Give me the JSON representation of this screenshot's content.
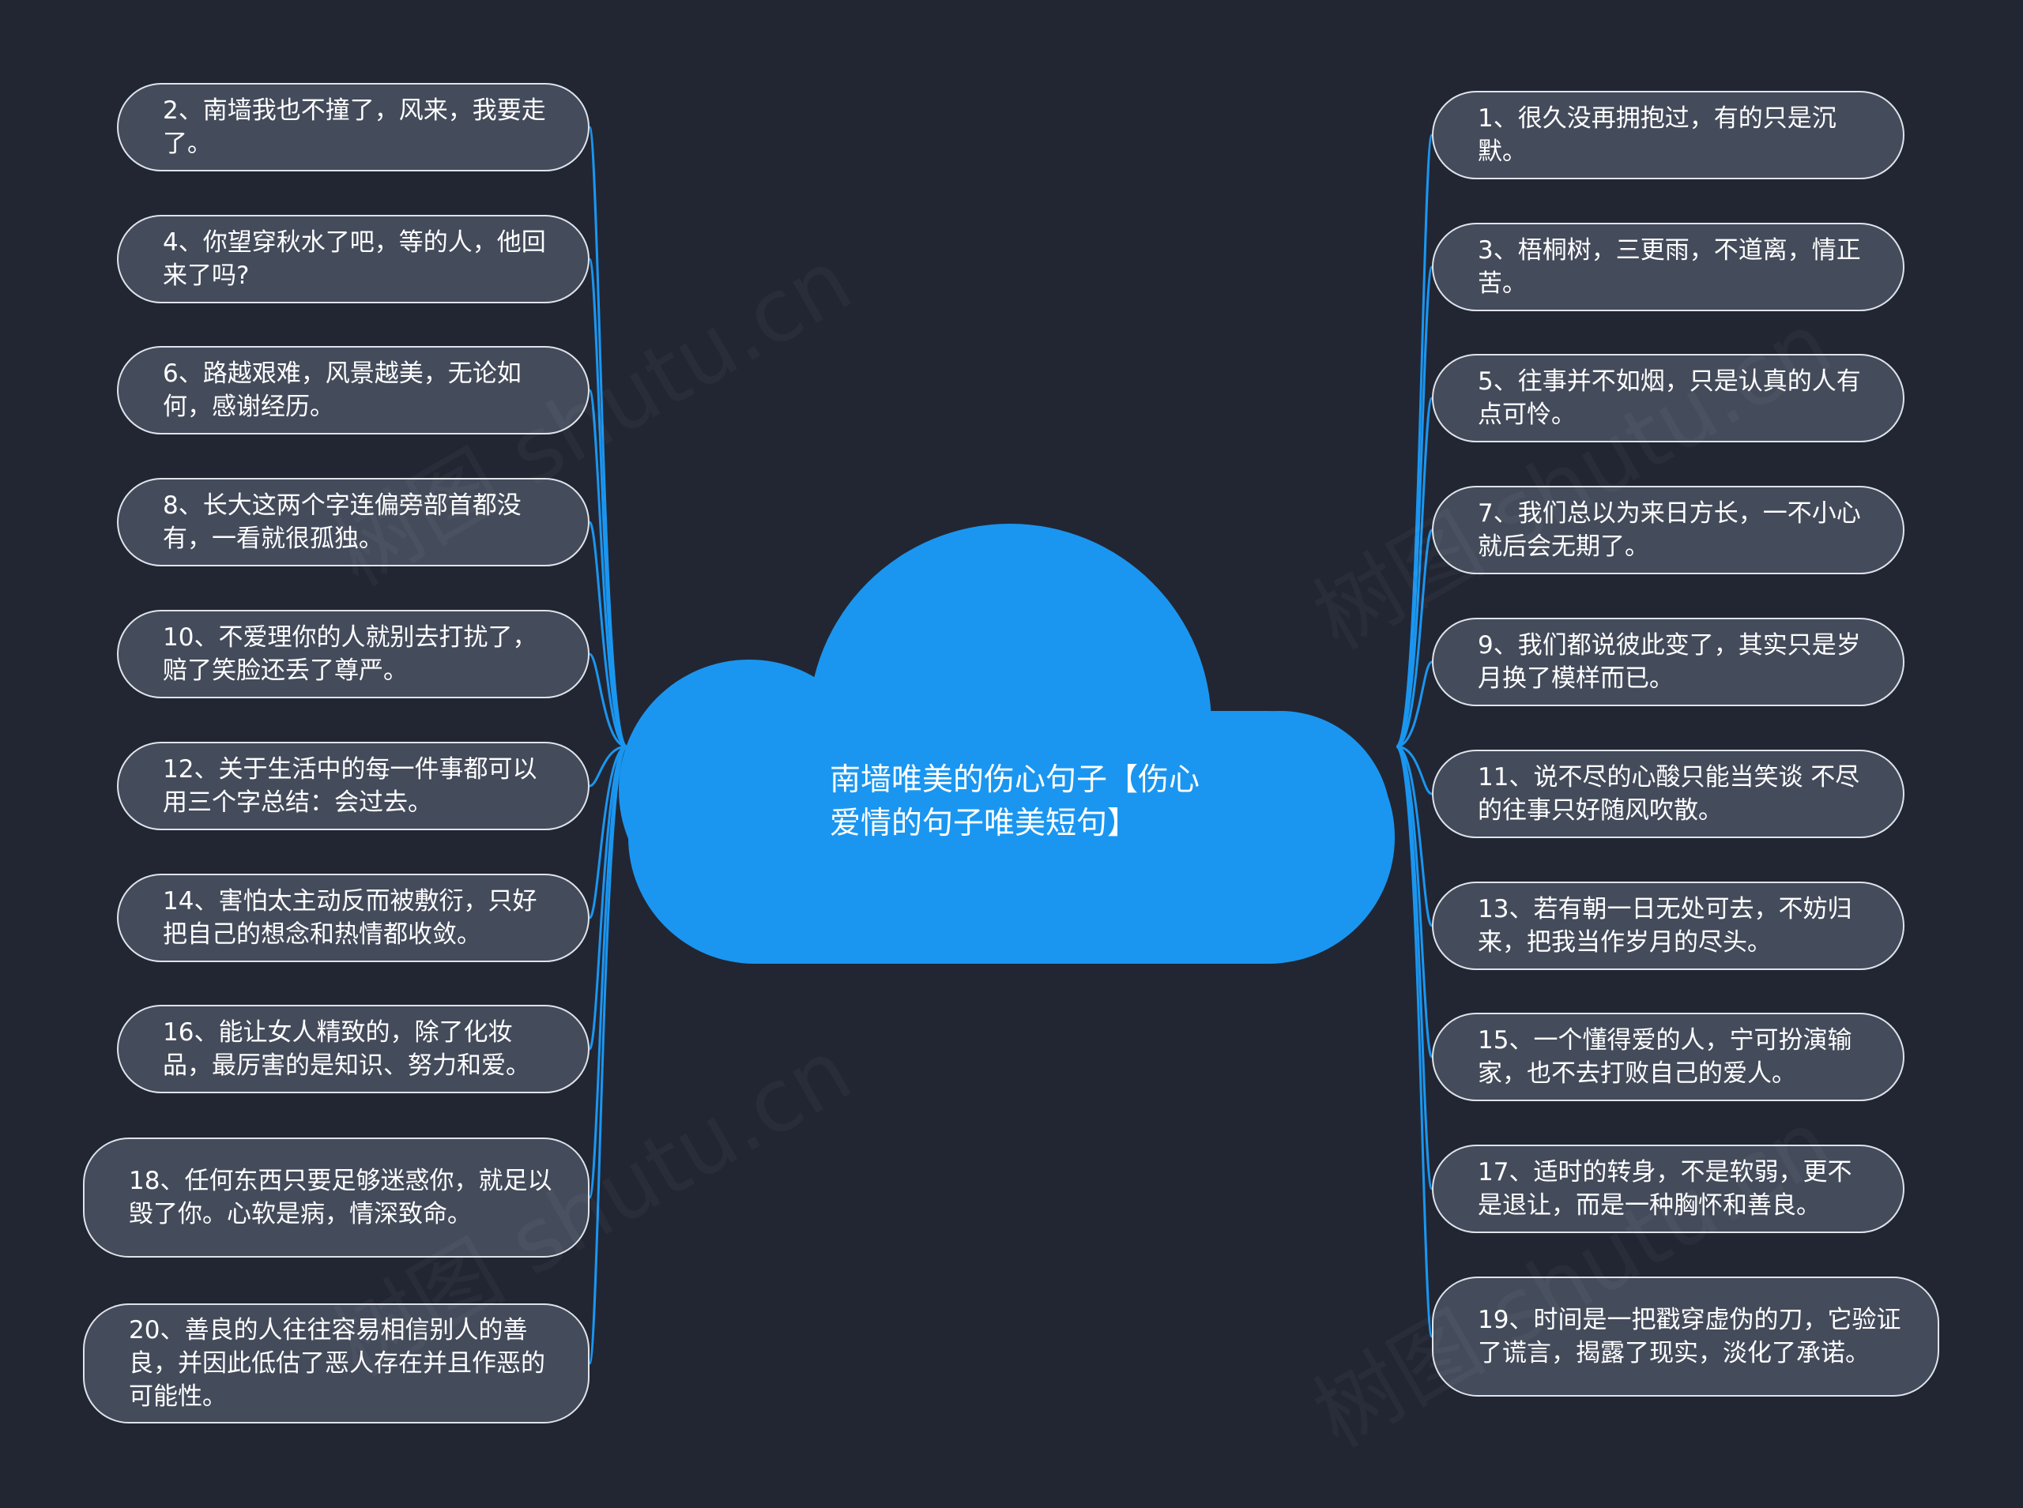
{
  "center": {
    "title": "南墙唯美的伤心句子【伤心爱情的句子唯美短句】"
  },
  "left_nodes": [
    "2、南墙我也不撞了，风来，我要走了。",
    "4、你望穿秋水了吧，等的人，他回来了吗?",
    "6、路越艰难，风景越美，无论如何，感谢经历。",
    "8、长大这两个字连偏旁部首都没有，一看就很孤独。",
    "10、不爱理你的人就别去打扰了，赔了笑脸还丢了尊严。",
    "12、关于生活中的每一件事都可以用三个字总结：会过去。",
    "14、害怕太主动反而被敷衍，只好把自己的想念和热情都收敛。",
    "16、能让女人精致的，除了化妆品，最厉害的是知识、努力和爱。",
    "18、任何东西只要足够迷惑你，就足以毁了你。心软是病，情深致命。",
    "20、善良的人往往容易相信别人的善良，并因此低估了恶人存在并且作恶的可能性。"
  ],
  "right_nodes": [
    "1、很久没再拥抱过，有的只是沉默。",
    "3、梧桐树，三更雨，不道离，情正苦。",
    "5、往事并不如烟，只是认真的人有点可怜。",
    "7、我们总以为来日方长，一不小心就后会无期了。",
    "9、我们都说彼此变了，其实只是岁月换了模样而已。",
    "11、说不尽的心酸只能当笑谈 不尽的往事只好随风吹散。",
    "13、若有朝一日无处可去，不妨归来，把我当作岁月的尽头。",
    "15、一个懂得爱的人，宁可扮演输家，也不去打败自己的爱人。",
    "17、适时的转身，不是软弱，更不是退让，而是一种胸怀和善良。",
    "19、时间是一把戳穿虚伪的刀，它验证了谎言，揭露了现实，淡化了承诺。"
  ],
  "watermark": "树图 shutu.cn",
  "colors": {
    "background": "#222633",
    "cloud": "#1a96f0",
    "node_fill": "#444b5b",
    "node_border": "#dfe3ea",
    "connector": "#1a96f0"
  }
}
